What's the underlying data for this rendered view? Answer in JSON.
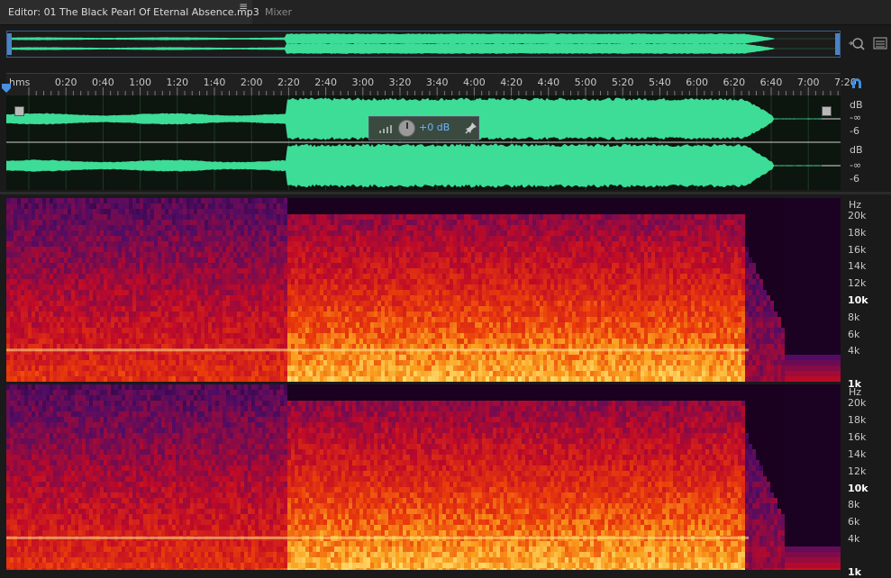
{
  "tabs": {
    "editor_label": "Editor: 01 The Black Pearl Of Eternal Absence.mp3",
    "menu_glyph": "≡",
    "mixer_label": "Mixer"
  },
  "ruler": {
    "unit": "hms",
    "ticks": [
      "0:20",
      "0:40",
      "1:00",
      "1:20",
      "1:40",
      "2:00",
      "2:20",
      "2:40",
      "3:00",
      "3:20",
      "3:40",
      "4:00",
      "4:20",
      "4:40",
      "5:00",
      "5:20",
      "5:40",
      "6:00",
      "6:20",
      "6:40",
      "7:00",
      "7:20"
    ]
  },
  "gain_hud": {
    "value": "+0 dB"
  },
  "amplitude_scale": {
    "channel1": {
      "unit": "dB",
      "inf": "-∞",
      "minus6": "-6"
    },
    "channel2": {
      "unit": "dB",
      "inf": "-∞",
      "minus6": "-6"
    }
  },
  "frequency_scale": {
    "top": {
      "unit": "Hz",
      "labels": [
        "20k",
        "18k",
        "16k",
        "14k",
        "12k",
        "10k",
        "8k",
        "6k",
        "4k",
        "1k"
      ]
    },
    "bottom": {
      "unit": "Hz",
      "labels": [
        "20k",
        "18k",
        "16k",
        "14k",
        "12k",
        "10k",
        "8k",
        "6k",
        "4k",
        "1k"
      ]
    }
  },
  "icons": [
    "zoom-to-selection-icon",
    "panel-list-icon",
    "snap-magnet-icon",
    "playhead-icon",
    "gain-meter-icon",
    "gain-knob-icon",
    "pin-icon"
  ],
  "colors": {
    "waveform": "#3ddc97",
    "spectral_low": "#3d0a5a",
    "spectral_high": "#ffe27a",
    "selection": "#4a83c4"
  }
}
